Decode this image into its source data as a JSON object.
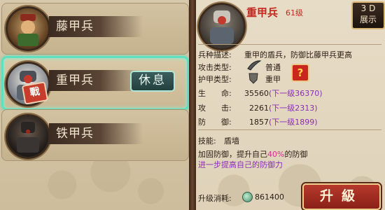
{
  "units": [
    {
      "name": "藤甲兵"
    },
    {
      "name": "重甲兵",
      "badge": "戰",
      "action": "休息"
    },
    {
      "name": "铁甲兵"
    }
  ],
  "detail": {
    "title": "重甲兵",
    "level": "61级",
    "btn3d_line1": "3 D",
    "btn3d_line2": "展示",
    "desc_label": "兵种描述:",
    "desc_value": "重甲的盾兵，防御比藤甲兵更高",
    "attack_type_label": "攻击类型:",
    "attack_type_value": "普通",
    "armor_type_label": "护甲类型:",
    "armor_type_value": "重甲",
    "unknown_glyph": "?",
    "stats": [
      {
        "label": "生　　命:",
        "value": "35560",
        "next_prefix": "(下一级",
        "next": "36370",
        "next_suffix": ")"
      },
      {
        "label": "攻　　击:",
        "value": "2261",
        "next_prefix": "(下一级",
        "next": "2313",
        "next_suffix": ")"
      },
      {
        "label": "防　　御:",
        "value": "1857",
        "next_prefix": "(下一级",
        "next": "1899",
        "next_suffix": ")"
      }
    ],
    "skill_label": "技能:",
    "skill_name": "盾墙",
    "skill_desc_pre": "加固防御，提升自己",
    "skill_desc_pct": "40%",
    "skill_desc_post": "的防御",
    "skill_desc_line2": "进一步提高自己的防御力",
    "cost_label": "升级消耗:",
    "cost_value": "861400",
    "upgrade_label": "升級"
  }
}
